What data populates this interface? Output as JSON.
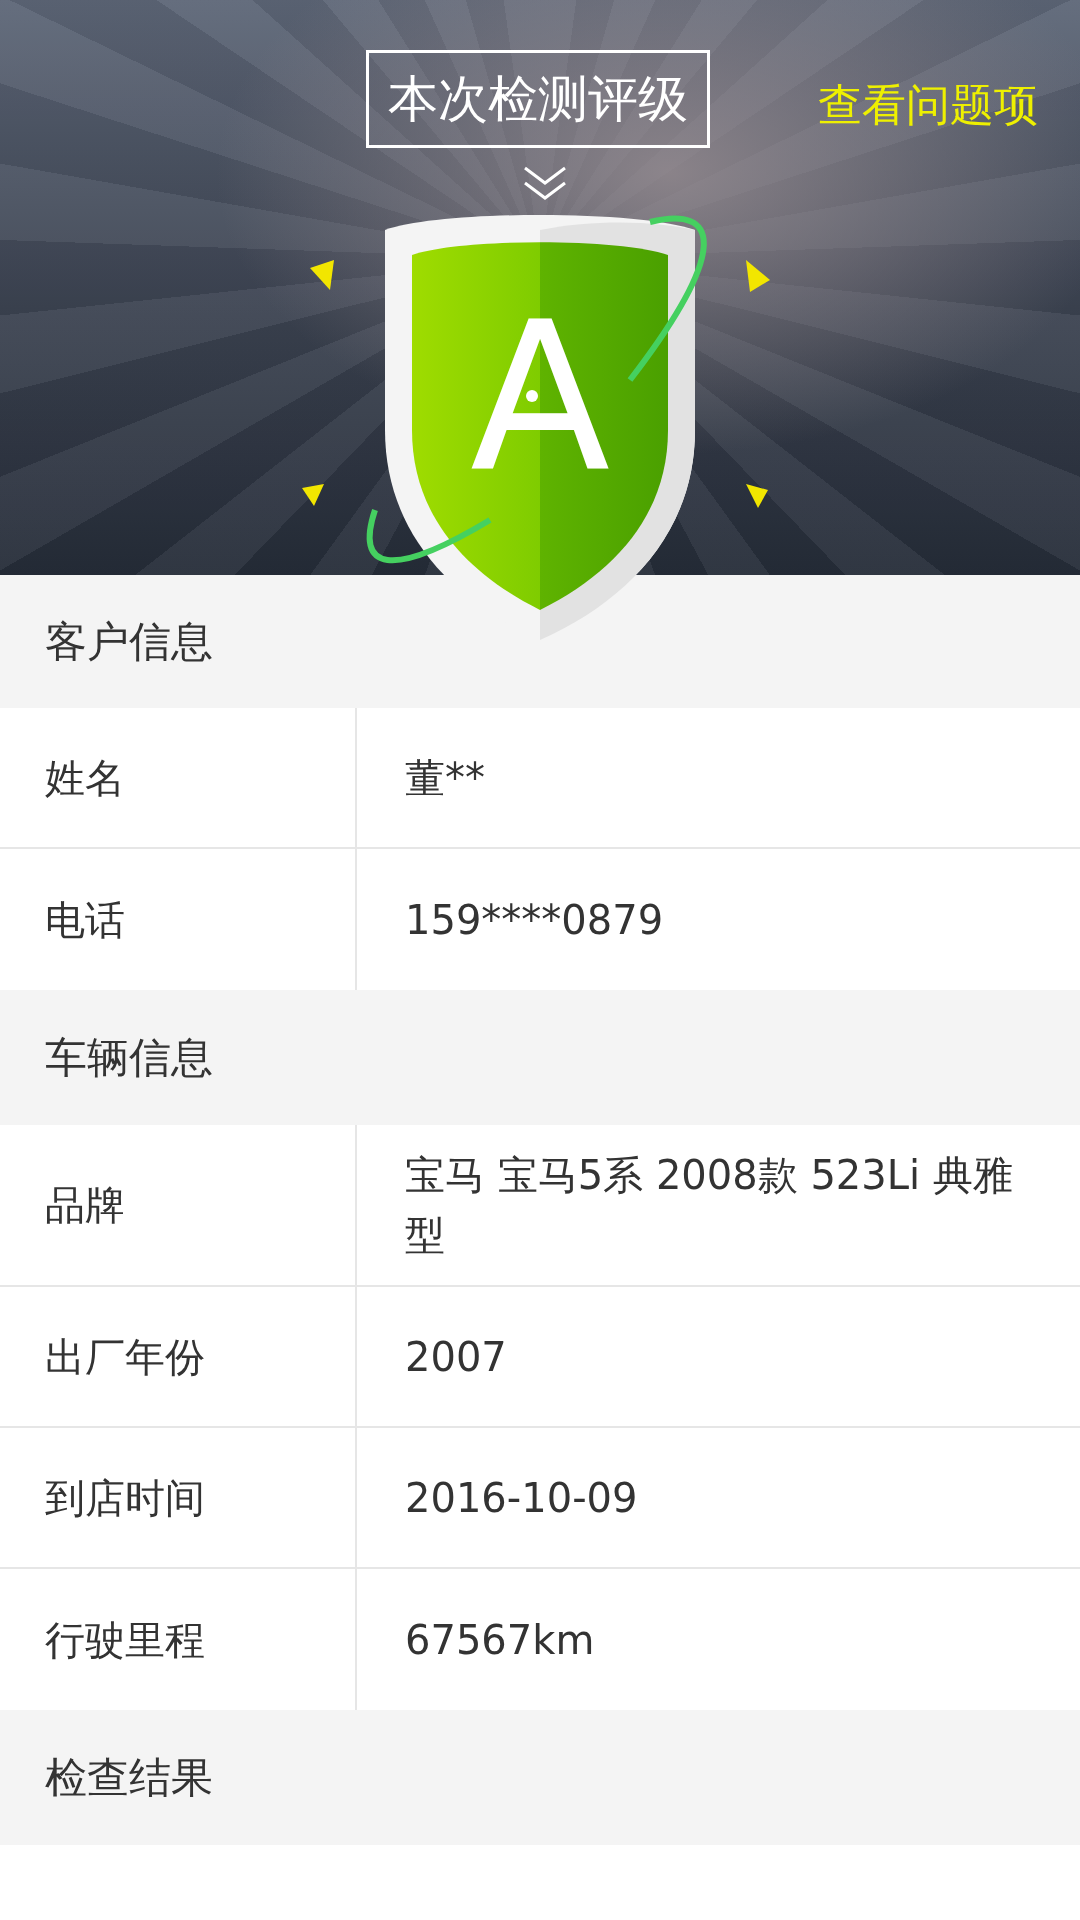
{
  "header": {
    "title": "本次检测评级",
    "link": "查看问题项",
    "grade": "A"
  },
  "sections": [
    {
      "title": "客户信息",
      "rows": [
        {
          "label": "姓名",
          "value": "董**"
        },
        {
          "label": "电话",
          "value": "159****0879"
        }
      ]
    },
    {
      "title": "车辆信息",
      "rows": [
        {
          "label": "品牌",
          "value": "宝马 宝马5系 2008款 523Li 典雅型"
        },
        {
          "label": "出厂年份",
          "value": "2007"
        },
        {
          "label": "到店时间",
          "value": "2016-10-09"
        },
        {
          "label": "行驶里程",
          "value": "67567km"
        }
      ]
    },
    {
      "title": "检查结果"
    }
  ]
}
